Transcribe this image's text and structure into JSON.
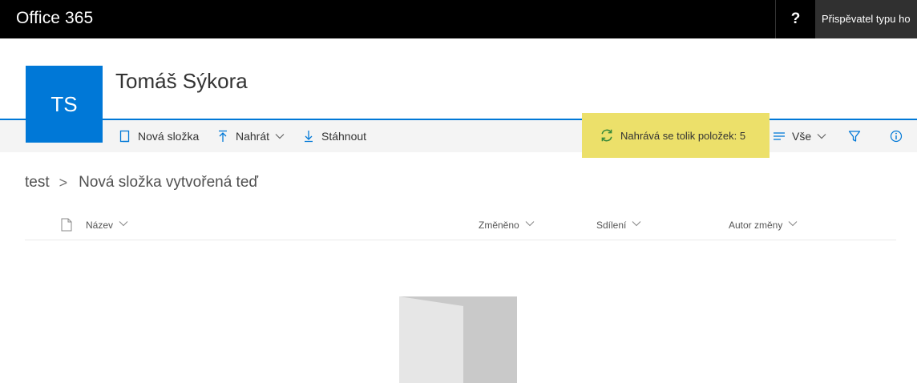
{
  "suitebar": {
    "app_title": "Office 365",
    "help_glyph": "?",
    "user_label": "Přispěvatel typu ho"
  },
  "site": {
    "logo_initials": "TS",
    "title": "Tomáš Sýkora"
  },
  "commandbar": {
    "new_folder": "Nová složka",
    "upload": "Nahrát",
    "download": "Stáhnout",
    "upload_status": "Nahrává se tolik položek: 5",
    "view": "Vše"
  },
  "breadcrumb": {
    "items": [
      "test",
      "Nová složka vytvořená teď"
    ],
    "separator": ">"
  },
  "columns": {
    "name": "Název",
    "modified": "Změněno",
    "shared": "Sdílení",
    "author": "Autor změny"
  },
  "colors": {
    "suite_bar": "#000000",
    "accent": "#0078d7",
    "status_highlight": "#ece06a",
    "command_bar_bg": "#f4f4f4"
  },
  "icons": {
    "new_folder": "new-folder-icon",
    "upload": "upload-icon",
    "download": "download-icon",
    "status": "sync-icon",
    "view": "view-options-icon",
    "filter": "filter-icon",
    "info": "info-icon",
    "file_type": "document-icon",
    "empty_state": "empty-folder-illustration"
  }
}
